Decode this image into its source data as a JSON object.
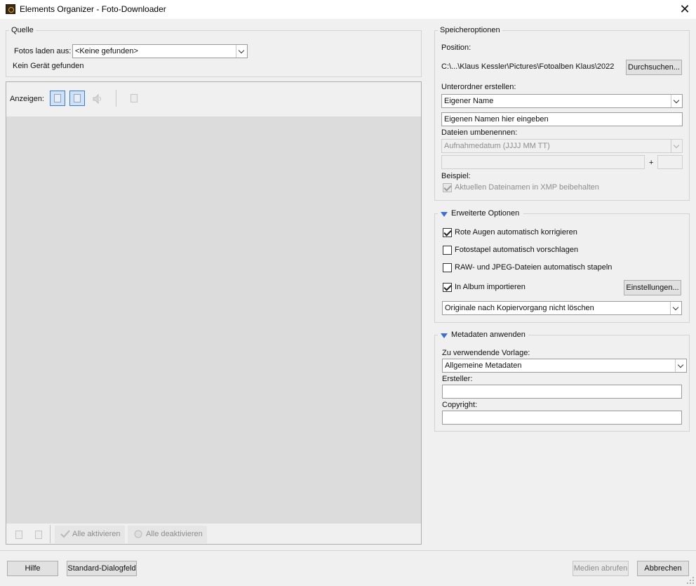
{
  "window": {
    "title": "Elements Organizer - Foto-Downloader",
    "close_glyph": "✕"
  },
  "source": {
    "group_label": "Quelle",
    "load_label": "Fotos laden aus:",
    "load_value": "<Keine gefunden>",
    "status": "Kein Gerät gefunden"
  },
  "view": {
    "label": "Anzeigen:",
    "icons": [
      "show-photos-icon",
      "show-videos-icon",
      "show-audio-icon",
      "show-files-icon"
    ]
  },
  "preview_footer": {
    "activate_all": "Alle aktivieren",
    "deactivate_all": "Alle deaktivieren"
  },
  "storage": {
    "group_label": "Speicheroptionen",
    "position_label": "Position:",
    "path": "C:\\...\\Klaus Kessler\\Pictures\\Fotoalben Klaus\\2022",
    "browse_button": "Durchsuchen...",
    "subfolder_label": "Unterordner erstellen:",
    "subfolder_value": "Eigener Name",
    "custom_name_value": "Eigenen Namen hier eingeben",
    "rename_label": "Dateien umbenennen:",
    "rename_value": "Aufnahmedatum (JJJJ MM TT)",
    "plus": "+",
    "example_label": "Beispiel:",
    "keep_xmp_label": "Aktuellen Dateinamen in XMP beibehalten",
    "keep_xmp_checked": true
  },
  "advanced": {
    "group_label": "Erweiterte Optionen",
    "options": [
      {
        "label": "Rote Augen automatisch korrigieren",
        "checked": true
      },
      {
        "label": "Fotostapel automatisch vorschlagen",
        "checked": false
      },
      {
        "label": "RAW- und JPEG-Dateien automatisch stapeln",
        "checked": false
      },
      {
        "label": "In Album importieren",
        "checked": true
      }
    ],
    "settings_button": "Einstellungen...",
    "after_copy_value": "Originale nach Kopiervorgang nicht löschen"
  },
  "metadata": {
    "group_label": "Metadaten anwenden",
    "template_label": "Zu verwendende Vorlage:",
    "template_value": "Allgemeine Metadaten",
    "creator_label": "Ersteller:",
    "creator_value": "",
    "copyright_label": "Copyright:",
    "copyright_value": ""
  },
  "footer": {
    "help": "Hilfe",
    "default_dialog": "Standard-Dialogfeld",
    "get_media": "Medien abrufen",
    "cancel": "Abbrechen"
  },
  "colors": {
    "accent": "#3a7bd5",
    "window_bg": "#f0f0f0",
    "preview_bg": "#dcdcdc"
  }
}
